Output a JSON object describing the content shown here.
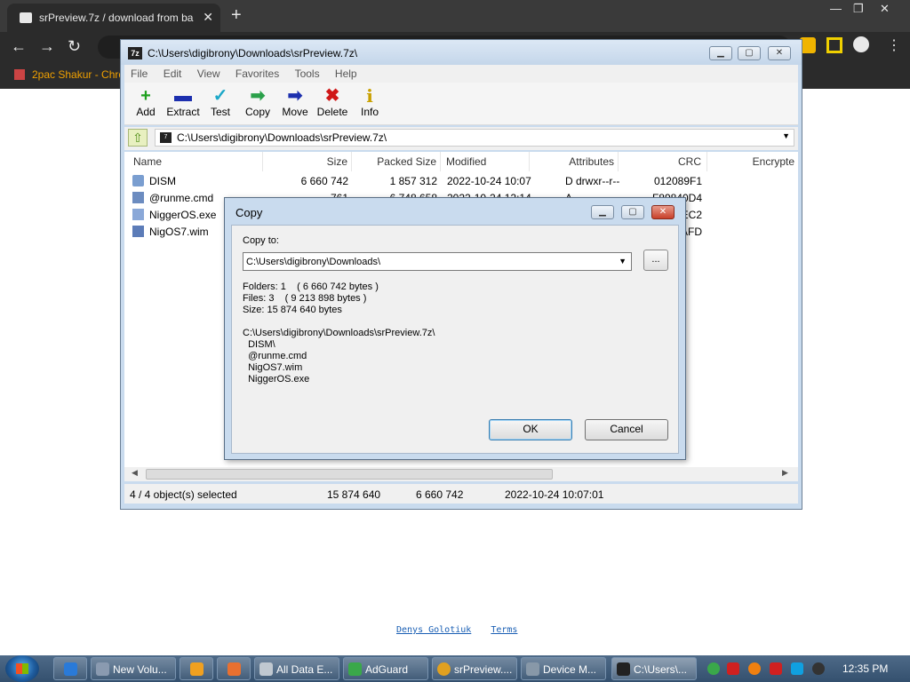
{
  "browser": {
    "tab_title": "srPreview.7z / download from ba",
    "tab_close": "✕",
    "new_tab": "+",
    "bookmark": "2pac Shakur - Chro",
    "nav_back": "←",
    "nav_forward": "→",
    "nav_reload": "↻"
  },
  "page": {
    "footer_author": "Denys Golotiuk",
    "footer_terms": "Terms"
  },
  "zip": {
    "title": "C:\\Users\\digibrony\\Downloads\\srPreview.7z\\",
    "app_icon": "7z",
    "menu": [
      "File",
      "Edit",
      "View",
      "Favorites",
      "Tools",
      "Help"
    ],
    "toolbar": [
      {
        "label": "Add",
        "icon": "plus-icon",
        "glyph": "+",
        "color": "#1ea01e"
      },
      {
        "label": "Extract",
        "icon": "minus-icon",
        "glyph": "▬",
        "color": "#1c2fae"
      },
      {
        "label": "Test",
        "icon": "check-icon",
        "glyph": "✓",
        "color": "#1ca8c8"
      },
      {
        "label": "Copy",
        "icon": "arrow-right-icon",
        "glyph": "➡",
        "color": "#2aa04a"
      },
      {
        "label": "Move",
        "icon": "arrow-right-icon",
        "glyph": "➡",
        "color": "#1c2fae"
      },
      {
        "label": "Delete",
        "icon": "x-icon",
        "glyph": "✖",
        "color": "#d01818"
      },
      {
        "label": "Info",
        "icon": "info-icon",
        "glyph": "i",
        "color": "#c8a000"
      }
    ],
    "address": "C:\\Users\\digibrony\\Downloads\\srPreview.7z\\",
    "columns": [
      "Name",
      "Size",
      "Packed Size",
      "Modified",
      "Attributes",
      "CRC",
      "Encrypte"
    ],
    "files": [
      {
        "name": "DISM",
        "size": "6 660 742",
        "packed": "1 857 312",
        "modified": "2022-10-24 10:07",
        "attributes": "D drwxr--r--",
        "crc": "012089F1",
        "icon": "folder-icon",
        "icon_color": "#7a9ed0"
      },
      {
        "name": "@runme.cmd",
        "size": "761",
        "packed": "6 748 658",
        "modified": "2022-10-24 12:14",
        "attributes": "A",
        "crc": "F89840D4",
        "icon": "file-icon",
        "icon_color": "#6c8cc0"
      },
      {
        "name": "NiggerOS.exe",
        "size": "",
        "packed": "",
        "modified": "",
        "attributes": "",
        "crc": "DEC2",
        "icon": "file-icon",
        "icon_color": "#8aa8d8"
      },
      {
        "name": "NigOS7.wim",
        "size": "",
        "packed": "",
        "modified": "",
        "attributes": "",
        "crc": "EAFD",
        "icon": "file-icon",
        "icon_color": "#5c7cb8"
      }
    ],
    "status": {
      "selection": "4 / 4 object(s) selected",
      "size": "15 874 640",
      "packed": "6 660 742",
      "modified": "2022-10-24 10:07:01"
    }
  },
  "dialog": {
    "title": "Copy",
    "copy_to_label": "Copy to:",
    "path": "C:\\Users\\digibrony\\Downloads\\",
    "browse": "...",
    "summary": "Folders: 1    ( 6 660 742 bytes )\nFiles: 3    ( 9 213 898 bytes )\nSize: 15 874 640 bytes",
    "source": "C:\\Users\\digibrony\\Downloads\\srPreview.7z\\\n  DISM\\\n  @runme.cmd\n  NigOS7.wim\n  NiggerOS.exe",
    "ok": "OK",
    "cancel": "Cancel"
  },
  "taskbar": {
    "items": [
      {
        "label": "",
        "icon": "ie-icon",
        "color": "#2a7ad8"
      },
      {
        "label": "New Volu...",
        "icon": "folder-icon",
        "color": "#8a9ab0"
      },
      {
        "label": "",
        "icon": "media-icon",
        "color": "#f0a020"
      },
      {
        "label": "",
        "icon": "app-icon",
        "color": "#e87030"
      },
      {
        "label": "All Data E...",
        "icon": "window-icon",
        "color": "#c0c8d0"
      },
      {
        "label": "AdGuard",
        "icon": "shield-icon",
        "color": "#3aa84a"
      },
      {
        "label": "srPreview....",
        "icon": "chrome-icon",
        "color": "#e0a020"
      },
      {
        "label": "Device M...",
        "icon": "device-icon",
        "color": "#8898a8"
      },
      {
        "label": "C:\\Users\\...",
        "icon": "zip-icon",
        "color": "#222222"
      }
    ],
    "clock": "12:35 PM"
  }
}
